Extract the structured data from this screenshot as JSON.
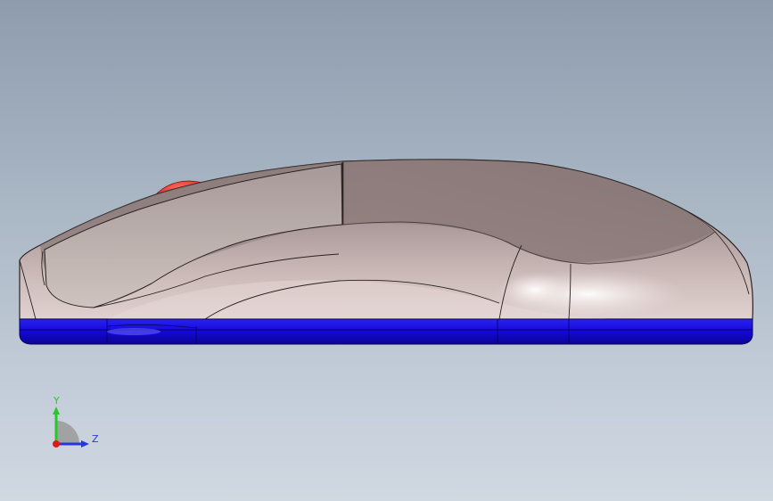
{
  "viewport": {
    "background_top": "#8e9cae",
    "background_bottom": "#d0d8e2"
  },
  "model": {
    "body_color": "#b8a6a4",
    "base_color": "#1a14e0",
    "wheel_color": "#e8302a"
  },
  "triad": {
    "y_label": "Y",
    "z_label": "Z",
    "y_color": "#29c829",
    "z_color": "#2838d8",
    "x_color": "#e01818"
  }
}
